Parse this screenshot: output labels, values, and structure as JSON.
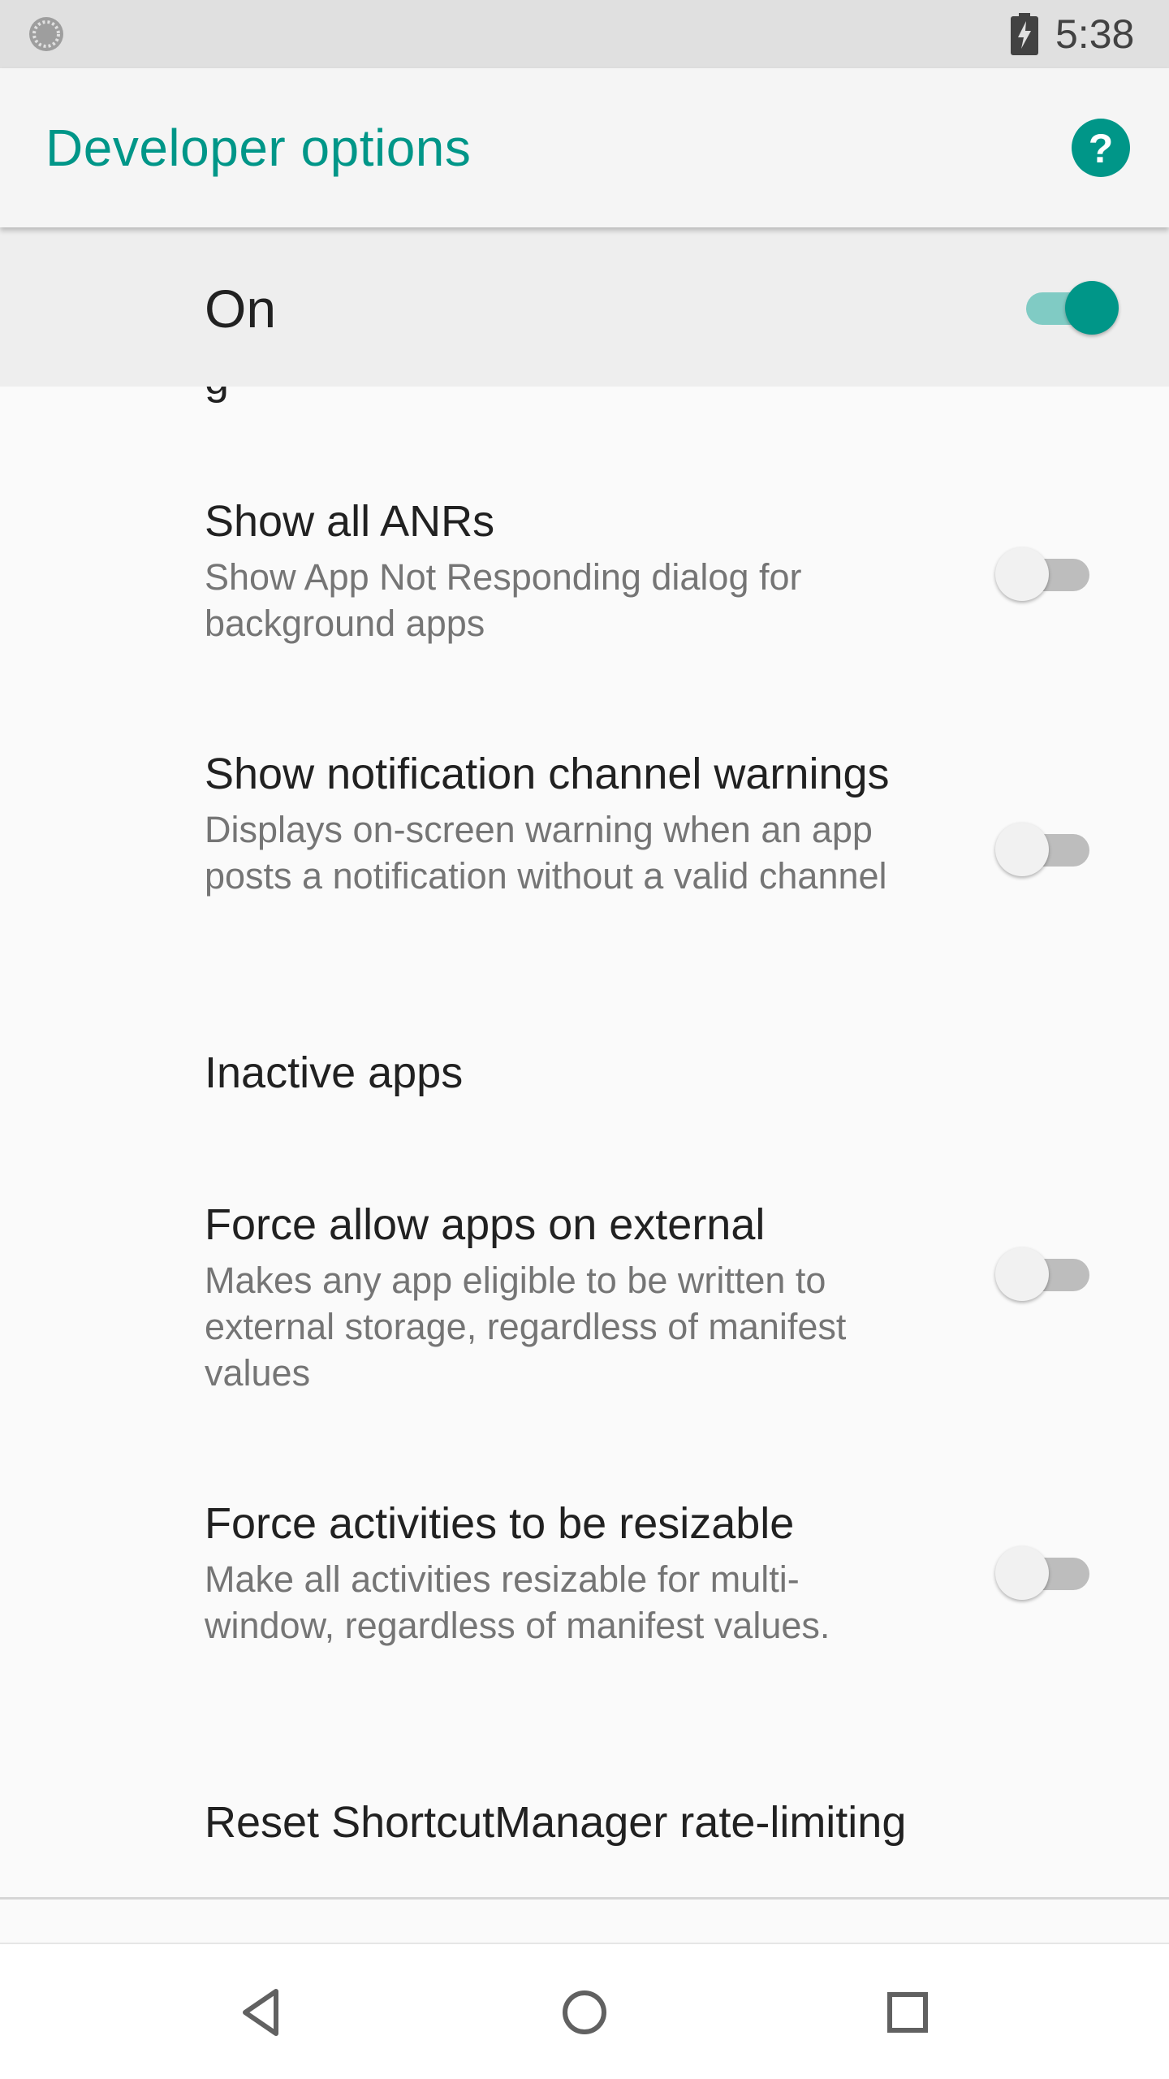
{
  "status_bar": {
    "time": "5:38",
    "icons": [
      "loading-spinner-icon",
      "battery-charging-icon"
    ]
  },
  "app_bar": {
    "title": "Developer options",
    "help_icon": "help-icon",
    "accent_color": "#009688"
  },
  "master_switch": {
    "label": "On",
    "checked": true
  },
  "settings": [
    {
      "title": "Show all ANRs",
      "summary": "Show App Not Responding dialog for background apps",
      "has_switch": true,
      "checked": false
    },
    {
      "title": "Show notification channel warnings",
      "summary": "Displays on-screen warning when an app posts a notification without a valid channel",
      "has_switch": true,
      "checked": false
    },
    {
      "title": "Inactive apps",
      "summary": "",
      "has_switch": false,
      "checked": false
    },
    {
      "title": "Force allow apps on external",
      "summary": "Makes any app eligible to be written to external storage, regardless of manifest values",
      "has_switch": true,
      "checked": false
    },
    {
      "title": "Force activities to be resizable",
      "summary": "Make all activities resizable for multi-window, regardless of manifest values.",
      "has_switch": true,
      "checked": false
    },
    {
      "title": "Reset ShortcutManager rate-limiting",
      "summary": "",
      "has_switch": false,
      "checked": false
    }
  ],
  "nav_bar": {
    "buttons": [
      "back-icon",
      "home-icon",
      "recents-icon"
    ]
  }
}
